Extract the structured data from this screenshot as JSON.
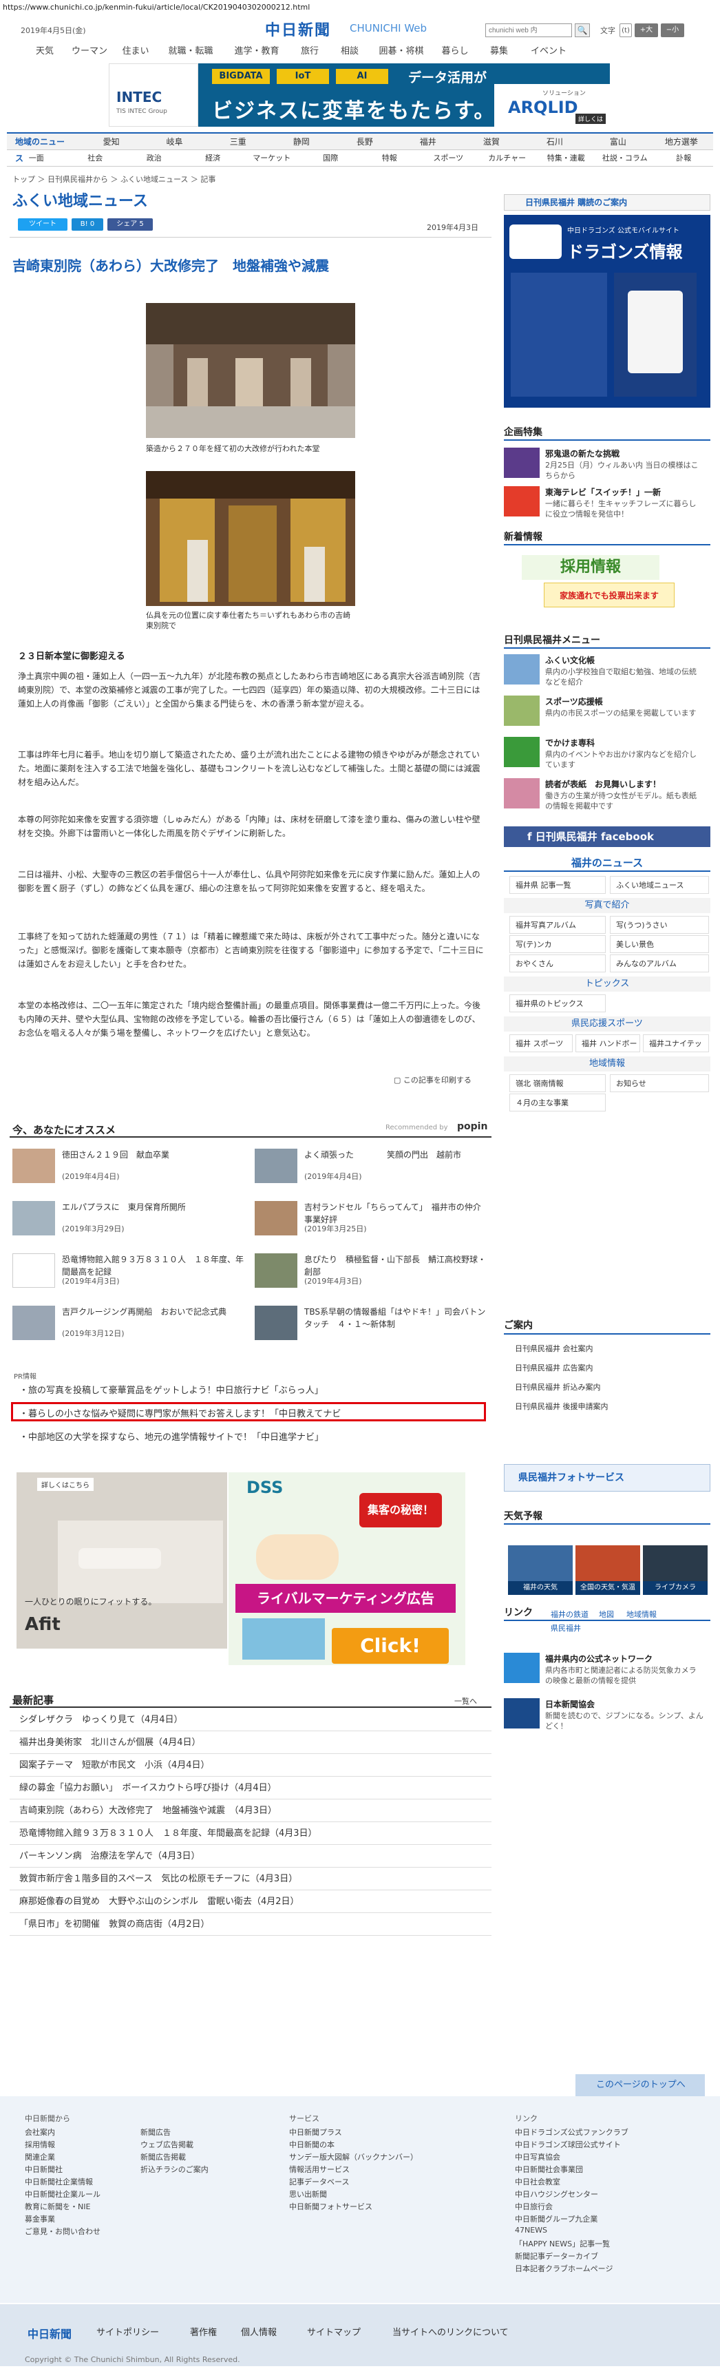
{
  "browser": {
    "url": "https://www.chunichi.co.jp/kenmin-fukui/article/local/CK2019040302000212.html"
  },
  "header": {
    "date": "2019年4月5日(金)",
    "logo": "中日新聞",
    "logo_sub": "CHUNICHI Web",
    "search_placeholder": "chunichi web 内",
    "search_button": "🔍",
    "fontsize_label": "文字",
    "fs_reset": "(t)",
    "fs_large": "+大",
    "fs_small": "−小"
  },
  "gnav": [
    "天気",
    "ウーマン",
    "住まい",
    "就職・転職",
    "進学・教育",
    "旅行",
    "暮らし",
    "囲碁・将棋",
    "暮らし",
    "ニュース",
    "イベント"
  ],
  "gnav_alt": {
    "items": [
      "天気",
      "ウーマン",
      "住まい",
      "就職・転職",
      "進学・教育",
      "旅行",
      "相談",
      "囲碁・将棋",
      "暮らし",
      "募集",
      "イベント"
    ]
  },
  "banner": {
    "company": "INTEC",
    "company_sub": "TIS INTEC Group",
    "chips": [
      "BIGDATA",
      "IoT",
      "AI"
    ],
    "line1": "データ活用が",
    "line2": "ビジネスに変革をもたらす。",
    "solution": "ソリューション",
    "product": "ARQLID",
    "more": "詳しくは"
  },
  "subnav": [
    "地域のニュース",
    "愛知",
    "岐阜",
    "三重",
    "静岡",
    "長野",
    "福井",
    "滋賀",
    "石川",
    "富山",
    "地方選挙"
  ],
  "subnav2": [
    "一面",
    "社会",
    "政治",
    "経済",
    "マーケット",
    "国際",
    "特報",
    "スポーツ",
    "カルチャー",
    "特集・連載",
    "社説・コラム",
    "訃報"
  ],
  "breadcrumb": "トップ ＞ 日刊県民福井から ＞ ふくい地域ニュース ＞ 記事",
  "section_title": "ふくい地域ニュース",
  "share": {
    "tweet": "ツイート",
    "hatena": "B! 0",
    "facebook": "シェア 5"
  },
  "article": {
    "published": "2019年4月3日",
    "headline": "吉崎東別院（あわら）大改修完了　地盤補強や減震",
    "caption1": "築造から２７０年を経て初の大改修が行われた本堂",
    "caption2": "仏具を元の位置に戻す奉仕者たち＝いずれもあわら市の吉崎東別院で",
    "subhead": "２３日新本堂に御影迎える",
    "paragraphs": [
      "浄土真宗中興の祖・蓮如上人（一四一五～九九年）が北陸布教の拠点としたあわら市吉崎地区にある真宗大谷派吉崎別院（吉崎東別院）で、本堂の改築補修と減震の工事が完了した。一七四四（延享四）年の築造以降、初の大規模改修。二十三日には蓮如上人の肖像画「御影（ごえい）」と全国から集まる門徒らを、木の香漂う新本堂が迎える。",
      "工事は昨年七月に着手。地山を切り崩して築造されたため、盛り土が流れ出たことによる建物の傾きやゆがみが懸念されていた。地面に薬剤を注入する工法で地盤を強化し、基礎もコンクリートを流し込むなどして補強した。土間と基礎の間には減震材を組み込んだ。",
      "本尊の阿弥陀如来像を安置する須弥壇（しゅみだん）がある「内陣」は、床材を研磨して漆を塗り重ね、傷みの激しい柱や壁材を交換。外廊下は雷雨いと一体化した雨風を防ぐデザインに刷新した。",
      "二日は福井、小松、大聖寺の三教区の若手僧侶ら十一人が奉仕し、仏具や阿弥陀如来像を元に戻す作業に励んだ。蓮如上人の御影を置く厨子（ずし）の飾などく仏具を運び、細心の注意を払って阿弥陀如来像を安置すると、経を唱えた。",
      "工事終了を知って訪れた蛭蓮蔵の男性（７１）は「精着に轢惹繊で来た時は、床板が外されて工事中だった。随分と違いになった」と感慨深げ。御影を護衛して東本願寺（京都市）と吉崎東別院を往復する「御影道中」に参加する予定で、「二十三日には蓮如さんをお迎えしたい」と手を合わせた。",
      "本堂の本格改修は、二〇一五年に策定された「境内総合整備計画」の最重点項目。関係事業費は一億二千万円に上った。今後も内陣の天井、壁や大型仏具、宝物館の改修を予定している。輪番の吾比優行さん（６５）は「蓮如上人の御遺德をしのび、お念仏を唱える人々が集う場を整備し、ネットワークを広げたい」と意気込む。"
    ],
    "print": "この記事を印刷する"
  },
  "osusume": {
    "title": "今、あなたにオススメ",
    "recommended_by": "Recommended by",
    "popin": "popin",
    "items": [
      {
        "title": "徳田さん２１９回　献血卒業",
        "date": "(2019年4月4日)"
      },
      {
        "title": "よく頑張った　　　　笑顔の門出　越前市",
        "date": "(2019年4月4日)"
      },
      {
        "title": "エルパプラスに　東月保育所開所",
        "date": "(2019年3月29日)"
      },
      {
        "title": "吉村ランドセル「ちらってんて」　福井市の仲介事業好評",
        "date": "(2019年3月25日)"
      },
      {
        "title": "恐竜博物館入館９３万８３１０人　１８年度、年間最高を記録",
        "date": "(2019年4月3日)"
      },
      {
        "title": "息ぴたり　積極監督・山下部長　鯖江高校野球・創部",
        "date": "(2019年4月3日)"
      },
      {
        "title": "吉戸クルージング再開船　おおいで記念式典",
        "date": "(2019年3月12日)"
      },
      {
        "title": "TBS系早朝の情報番組「はやドキ！」司会バトンタッチ　４・１〜新体制",
        "date": ""
      }
    ]
  },
  "pr": {
    "label": "PR情報",
    "links": [
      "旅の写真を投稿して豪華賞品をゲットしよう！中日旅行ナビ「ぶらっ人」",
      "暮らしの小さな悩みや疑問に専門家が無料でお答えします！「中日教えてナビ",
      "中部地区の大学を探すなら、地元の進学情報サイトで！「中日進学ナビ」"
    ]
  },
  "ads": {
    "afit_badge": "詳しくはこちら",
    "afit_copy": "一人ひとりの眠りにフィットする。",
    "afit_brand": "Afit",
    "dss": "DSS",
    "dss_secret": "集客の秘密！",
    "dss_rival": "ライバルマーケティング広告",
    "dss_click": "Click!"
  },
  "latest": {
    "title": "最新記事",
    "more": "一覧へ",
    "items": [
      "シダレザクラ　ゆっくり見て（4月4日）",
      "福井出身美術家　北川さんが個展（4月4日）",
      "図案子テーマ　短歌が市民文　小浜（4月4日）",
      "緑の募金「協力お願い」　ボーイスカウトら呼び掛け（4月4日）",
      "吉崎東別院（あわら）大改修完了　地盤補強や減震　（4月3日）",
      "恐竜博物館入館９３万８３１０人　１８年度、年間最高を記録（4月3日）",
      "パーキンソン病　治療法を学んで（4月3日）",
      "敦賀市新庁舎１階多目的スペース　気比の松原モチーフに（4月3日）",
      "麻那姫像春の目覚め　大野やぶ山のシンボル　雷眠い衛去（4月2日）",
      "「県日市」を初開催　敦賀の商店街（4月2日）"
    ]
  },
  "sidebar": {
    "subscribe": "日刊県民福井 購読のご案内",
    "dragons_head": "中日ドラゴンズ 公式モバイルサイト",
    "dragons_title": "ドラゴンズ情報",
    "kikaku": "企画特集",
    "kikaku_items": [
      {
        "t1": "邪鬼退の新たな挑戦",
        "t2": "2月25日（月）ウィルあい内 当日の模様はこちらから"
      },
      {
        "t1": "東海テレビ「スイッチ！」一新",
        "t2": "一緒に暮らそ！生キャッチフレーズに暮らしに役立つ情報を発信中！"
      }
    ],
    "shinsa": "新着情報",
    "saiyo": "採用情報",
    "saiyo_sub": "家族通れでも投票出来ます",
    "kenmin_menu": "日刊県民福井メニュー",
    "menu_items": [
      {
        "t1": "ふくい文化帳",
        "t2": "県内の小学校独自で取組む勉強、地域の伝統などを紹介"
      },
      {
        "t1": "スポーツ応援帳",
        "t2": "県内の市民スポーツの結果を掲載しています"
      },
      {
        "t1": "でかけま専科",
        "t2": "県内のイベントやお出かけ家内などを紹介しています"
      },
      {
        "t1": "読者が表紙　お見舞いします！",
        "t2": "働き方の生業が待つ女性がモデル。紙も表紙の情報を掲載中です"
      }
    ],
    "facebook": "日刊県民福井 facebook",
    "fukui_news": "福井のニュース",
    "grid1": [
      "福井県 記事一覧",
      "ふくい地域ニュース"
    ],
    "photo_head": "写真で紹介",
    "grid2": [
      "福井写真アルバム",
      "写(うつ)うさい",
      "写(テ)ンカ",
      "美しい景色",
      "おやくさん",
      "みんなのアルバム"
    ],
    "topics_head": "トピックス",
    "grid3": [
      "福井県のトピックス"
    ],
    "sports_head": "県民応援スポーツ",
    "grid4": [
      "福井 スポーツ",
      "福井 ハンドボール",
      "福井ユナイテッドFC"
    ],
    "region_head": "地域情報",
    "grid5": [
      "嶺北 嶺南情報",
      "お知らせ",
      "４月の主な事業"
    ],
    "goannai": "ご案内",
    "grid6": [
      "日刊県民福井 会社案内",
      "日刊県民福井 広告案内",
      "日刊県民福井 折込み案内",
      "日刊県民福井 後援申請案内"
    ],
    "service_head": "県民福井フォトサービス",
    "weather_head": "天気予報",
    "weather": [
      "福井の天気",
      "全国の天気・気温",
      "ライブカメラ"
    ],
    "link_head": "リンク",
    "links": [
      "福井の鉄道",
      "地図",
      "地域情報",
      "県民福井"
    ],
    "link_items": [
      {
        "t1": "福井県内の公式ネットワーク",
        "t2": "県内各市町と関連記者による防災気象カメラの映像と最新の情報を提供"
      },
      {
        "t1": "日本新聞協会",
        "t2": "新聞を読むので、ジブンになる。シンプ、よんどく！"
      }
    ]
  },
  "footer": {
    "pagetop": "このページのトップへ",
    "col1_head": "中日新聞から",
    "col1": [
      "会社案内",
      "採用情報",
      "関連企業",
      "中日新聞社",
      "中日新聞社企業情報",
      "中日新聞社企業ルール",
      "教育に新聞を・NIE",
      "募金事業",
      "ご意見・お問い合わせ"
    ],
    "col2": [
      "新聞広告",
      "ウェブ広告掲載",
      "新聞広告掲載",
      "折込チラシのご案内"
    ],
    "col3_head": "サービス",
    "col3": [
      "中日新聞プラス",
      "中日新聞の本",
      "サンデー版大図解（バックナンバー）",
      "情報活用サービス",
      "記事データベース",
      "思い出新聞",
      "中日新聞フォトサービス"
    ],
    "col4_head": "リンク",
    "col4": [
      "中日ドラゴンズ公式ファンクラブ",
      "中日ドラゴンズ球団公式サイト",
      "中日写真協会",
      "中日新聞社会事業団",
      "中日社会教室",
      "中日ハウジングセンター",
      "中日旅行会",
      "中日新聞グループ九企業",
      "47NEWS",
      "「HAPPY NEWS」記事一覧",
      "新聞記事データーカイブ",
      "日本記者クラブホームページ"
    ],
    "logo": "中日新聞",
    "bar_links": [
      "サイトポリシー",
      "著作権",
      "個人情報",
      "サイトマップ",
      "当サイトへのリンクについて"
    ],
    "copyright": "Copyright © The Chunichi Shimbun, All Rights Reserved."
  },
  "colors": {
    "accent": "#1a5fb4",
    "highlight_box": "#e0000b",
    "facebook": "#3b5998",
    "twitter": "#1da1f2"
  }
}
